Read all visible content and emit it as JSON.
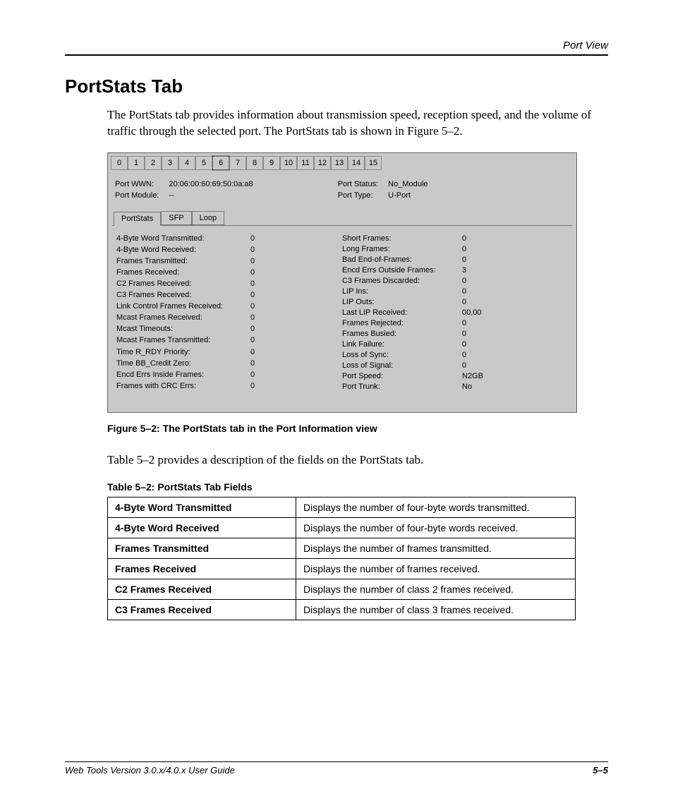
{
  "header": {
    "section": "Port View"
  },
  "heading": "PortStats Tab",
  "intro": "The PortStats tab provides information about transmission speed, reception speed, and the volume of traffic through the selected port. The PortStats tab is shown in Figure 5–2.",
  "screenshot": {
    "port_tabs": [
      "0",
      "1",
      "2",
      "3",
      "4",
      "5",
      "6",
      "7",
      "8",
      "9",
      "10",
      "11",
      "12",
      "13",
      "14",
      "15"
    ],
    "selected_port_tab": "6",
    "info": {
      "wwn_label": "Port WWN:",
      "wwn_value": "20:06:00:60:69:50:0a:a8",
      "module_label": "Port Module:",
      "module_value": "--",
      "status_label": "Port Status:",
      "status_value": "No_Module",
      "type_label": "Port Type:",
      "type_value": "U-Port"
    },
    "subtabs": {
      "portstats": "PortStats",
      "sfp": "SFP",
      "loop": "Loop"
    },
    "left_stats": [
      {
        "k": "4-Byte Word Transmitted:",
        "v": "0"
      },
      {
        "k": "4-Byte Word Received:",
        "v": "0"
      },
      {
        "k": "Frames Transmitted:",
        "v": "0"
      },
      {
        "k": "Frames Received:",
        "v": "0"
      },
      {
        "k": "C2 Frames Received:",
        "v": "0"
      },
      {
        "k": "C3 Frames Received:",
        "v": "0"
      },
      {
        "k": "Link Control Frames Received:",
        "v": "0"
      },
      {
        "k": "Mcast Frames Received:",
        "v": "0"
      },
      {
        "k": "Mcast Timeouts:",
        "v": "0"
      },
      {
        "k": "Mcast Frames Transmitted:",
        "v": "0"
      },
      {
        "k": "Time R_RDY Priority:",
        "v": "0"
      },
      {
        "k": "Time BB_Credit Zero:",
        "v": "0"
      },
      {
        "k": "Encd Errs Inside Frames:",
        "v": "0"
      },
      {
        "k": "Frames with CRC Errs:",
        "v": "0"
      }
    ],
    "right_stats": [
      {
        "k": "Short Frames:",
        "v": "0"
      },
      {
        "k": "Long Frames:",
        "v": "0"
      },
      {
        "k": "Bad End-of-Frames:",
        "v": "0"
      },
      {
        "k": "Encd Errs Outside Frames:",
        "v": "3"
      },
      {
        "k": "C3 Frames Discarded:",
        "v": "0"
      },
      {
        "k": "LIP Ins:",
        "v": "0"
      },
      {
        "k": "LIP Outs:",
        "v": "0"
      },
      {
        "k": "Last LIP Received:",
        "v": "00,00"
      },
      {
        "k": "Frames Rejected:",
        "v": "0"
      },
      {
        "k": "Frames Busied:",
        "v": "0"
      },
      {
        "k": "Link Failure:",
        "v": "0"
      },
      {
        "k": "Loss of Sync:",
        "v": "0"
      },
      {
        "k": "Loss of Signal:",
        "v": "0"
      },
      {
        "k": "Port Speed:",
        "v": "N2GB"
      },
      {
        "k": "Port Trunk:",
        "v": "No"
      }
    ]
  },
  "fig_caption": "Figure 5–2:  The PortStats tab in the Port Information view",
  "table_intro": "Table 5–2 provides a description of the fields on the PortStats tab.",
  "table_caption": "Table 5–2:  PortStats Tab Fields",
  "table_rows": [
    {
      "k": "4-Byte Word Transmitted",
      "v": "Displays the number of four-byte words transmitted."
    },
    {
      "k": "4-Byte Word Received",
      "v": "Displays the number of four-byte words received."
    },
    {
      "k": "Frames Transmitted",
      "v": "Displays the number of frames transmitted."
    },
    {
      "k": "Frames Received",
      "v": "Displays the number of frames received."
    },
    {
      "k": "C2 Frames Received",
      "v": "Displays the number of class 2 frames received."
    },
    {
      "k": "C3 Frames Received",
      "v": "Displays the number of class 3 frames received."
    }
  ],
  "footer": {
    "left": "Web Tools Version 3.0.x/4.0.x User Guide",
    "right": "5–5"
  }
}
